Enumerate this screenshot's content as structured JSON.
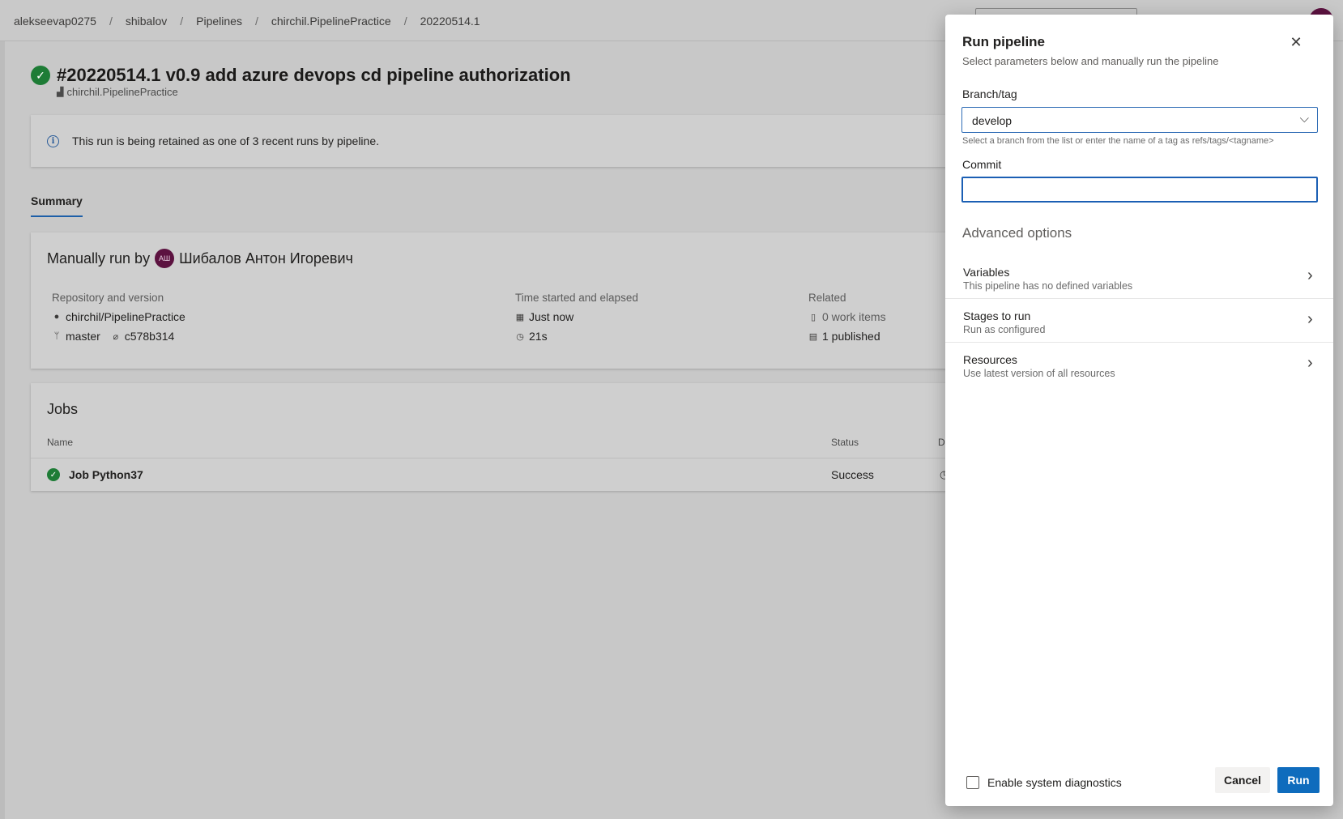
{
  "breadcrumb": {
    "items": [
      "alekseevap0275",
      "shibalov",
      "Pipelines",
      "chirchil.PipelinePractice",
      "20220514.1"
    ],
    "separator": "/"
  },
  "run": {
    "title": "#20220514.1 v0.9 add azure devops cd pipeline authorization",
    "pipeline": "chirchil.PipelinePractice",
    "banner": "This run is being retained as one of 3 recent runs by pipeline."
  },
  "tabs": {
    "summary": "Summary"
  },
  "summary": {
    "manual_prefix": "Manually run by",
    "avatar_initials": "АШ",
    "user": "Шибалов Антон Игоревич",
    "repo_header": "Repository and version",
    "repo": "chirchil/PipelinePractice",
    "branch": "master",
    "commit": "c578b314",
    "time_header": "Time started and elapsed",
    "started": "Just now",
    "elapsed": "21s",
    "related_header": "Related",
    "work_items": "0 work items",
    "published": "1 published"
  },
  "jobs": {
    "title": "Jobs",
    "col_name": "Name",
    "col_status": "Status",
    "col_duration_partial": "D",
    "rows": [
      {
        "name": "Job Python37",
        "status": "Success"
      }
    ]
  },
  "dialog": {
    "title": "Run pipeline",
    "subtitle": "Select parameters below and manually run the pipeline",
    "branch_label": "Branch/tag",
    "branch_value": "develop",
    "branch_hint": "Select a branch from the list or enter the name of a tag as refs/tags/<tagname>",
    "commit_label": "Commit",
    "commit_value": "",
    "advanced_title": "Advanced options",
    "options": [
      {
        "title": "Variables",
        "desc": "This pipeline has no defined variables"
      },
      {
        "title": "Stages to run",
        "desc": "Run as configured"
      },
      {
        "title": "Resources",
        "desc": "Use latest version of all resources"
      }
    ],
    "diagnostics_label": "Enable system diagnostics",
    "diagnostics_checked": false,
    "cancel_label": "Cancel",
    "run_label": "Run"
  },
  "colors": {
    "accent": "#0f6cbd",
    "success": "#1e7c36",
    "avatar": "#5c1240"
  }
}
